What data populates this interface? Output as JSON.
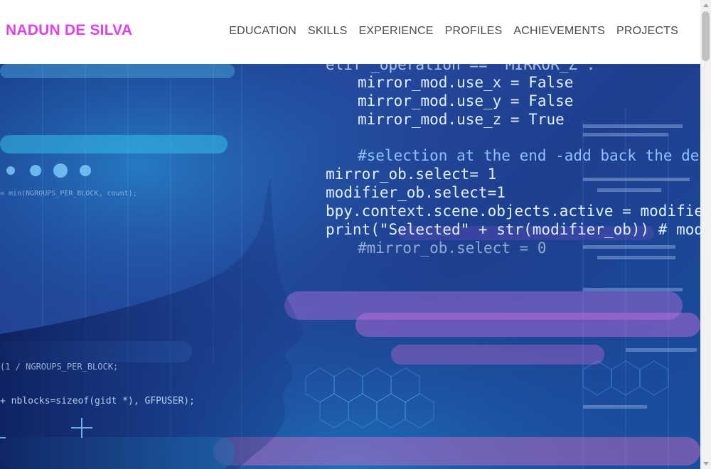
{
  "header": {
    "brand": "NADUN DE SILVA",
    "nav": [
      {
        "label": "EDUCATION"
      },
      {
        "label": "SKILLS"
      },
      {
        "label": "EXPERIENCE"
      },
      {
        "label": "PROFILES"
      },
      {
        "label": "ACHIEVEMENTS"
      },
      {
        "label": "PROJECTS"
      }
    ]
  },
  "hero": {
    "code_lines": [
      "elif _operation == \"MIRROR_Z\":",
      "mirror_mod.use_x = False",
      "mirror_mod.use_y = False",
      "mirror_mod.use_z = True",
      "#selection at the end -add back the desel",
      "mirror_ob.select= 1",
      "modifier_ob.select=1",
      "bpy.context.scene.objects.active = modifier_o",
      "print(\"Selected\" + str(modifier_ob)) # modifi",
      "#mirror_ob.select = 0"
    ],
    "left_code": [
      "+ nblocks=sizeof(gidt *), GFPUSER);",
      "(1 / NGROUPS_PER_BLOCK;",
      "= min(NGROUPS_PER_BLOCK, count);"
    ]
  },
  "colors": {
    "brand": "#e040e8",
    "nav_text": "#4a4a4a",
    "hero_blue": "#1e3f8e"
  }
}
